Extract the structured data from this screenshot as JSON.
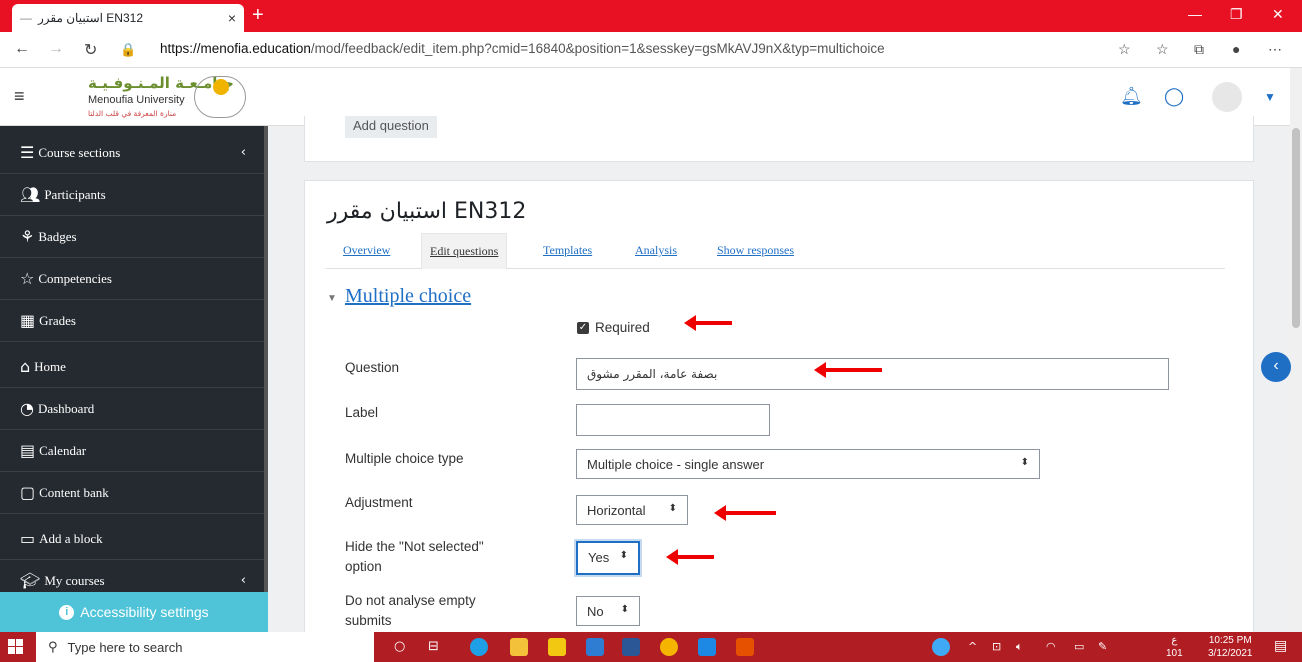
{
  "browser": {
    "tab_title": "استبيان مقرر EN312",
    "tab_close": "×",
    "new_tab": "+",
    "url_host": "https://menofia.education",
    "url_path": "/mod/feedback/edit_item.php?cmid=16840&position=1&sesskey=gsMkAVJ9nX&typ=multichoice"
  },
  "header": {
    "logo_ar": "جـامـعـة المـنـوفـيـة",
    "logo_en": "Menoufia University",
    "logo_sub": "منارة المعرفة في قلب الدلتا"
  },
  "drawer": {
    "items": [
      {
        "label": "Course sections",
        "icon": "list-icon"
      },
      {
        "label": "Participants",
        "icon": "users-icon"
      },
      {
        "label": "Badges",
        "icon": "badges-icon"
      },
      {
        "label": "Competencies",
        "icon": "star-icon"
      },
      {
        "label": "Grades",
        "icon": "table-icon"
      },
      {
        "label": "Home",
        "icon": "home-icon"
      },
      {
        "label": "Dashboard",
        "icon": "dashboard-icon"
      },
      {
        "label": "Calendar",
        "icon": "calendar-icon"
      },
      {
        "label": "Content bank",
        "icon": "clipboard-icon"
      },
      {
        "label": "Add a block",
        "icon": "folder-icon"
      },
      {
        "label": "My courses",
        "icon": "mortarboard-icon"
      }
    ],
    "accessibility": "Accessibility settings"
  },
  "main": {
    "add_question": "Add question",
    "feedback_title": "استبيان مقرر EN312",
    "tabs": [
      "Overview",
      "Edit questions",
      "Templates",
      "Analysis",
      "Show responses"
    ],
    "section_title": "Multiple choice",
    "required_label": "Required",
    "fields": {
      "question_label": "Question",
      "question_value": "بصفة عامة، المقرر مشوق",
      "label_label": "Label",
      "label_value": "",
      "mc_type_label": "Multiple choice type",
      "mc_type_value": "Multiple choice - single answer",
      "adjustment_label": "Adjustment",
      "adjustment_value": "Horizontal",
      "hide_label_1": "Hide the \"Not selected\"",
      "hide_label_2": "option",
      "hide_value": "Yes",
      "empty_label_1": "Do not analyse empty",
      "empty_label_2": "submits",
      "empty_value": "No"
    }
  },
  "taskbar": {
    "search_placeholder": "Type here to search",
    "time": "10:25 PM",
    "date": "3/12/2021",
    "lang_top": "ع",
    "lang_bottom": "101"
  },
  "colors": {
    "accent": "#1f6fc5",
    "tabbar": "#e81123",
    "drawer": "#252a30",
    "access": "#4fc4d8",
    "arrow": "#e00000"
  }
}
